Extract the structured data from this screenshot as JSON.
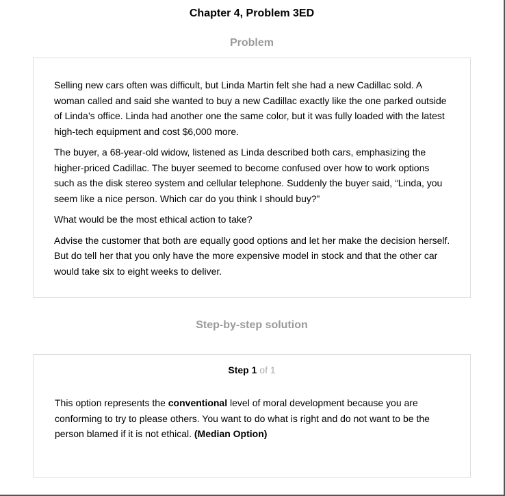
{
  "page": {
    "title": "Chapter 4, Problem 3ED"
  },
  "problem": {
    "heading": "Problem",
    "paragraphs": [
      "Selling new cars often was difficult, but Linda Martin felt she had a new Cadillac sold. A woman called and said she wanted to buy a new Cadillac exactly like the one parked outside of Linda’s office. Linda had another one the same color, but it was fully loaded with the latest high-tech equipment and cost $6,000 more.",
      "The buyer, a 68-year-old widow, listened as Linda described both cars, emphasizing the higher-priced Cadillac. The buyer seemed to become confused over how to work options such as the disk stereo system and cellular telephone. Suddenly the buyer said, “Linda, you seem like a nice person. Which car do you think I should buy?”",
      "What would be the most ethical action to take?",
      "Advise the customer that both are equally good options and let her make the decision herself. But do tell her that you only have the more expensive model in stock and that the other car would take six to eight weeks to deliver."
    ]
  },
  "solution": {
    "heading": "Step-by-step solution",
    "step_word": "Step",
    "step_number": "1",
    "step_of": "of 1",
    "text_part1": "This option represents the ",
    "text_bold1": "conventional",
    "text_part2": " level of moral development because you are conforming to try to please others. You want to do what is right and do not want to be the person blamed if it is not ethical. ",
    "text_bold2": "(Median Option)"
  }
}
